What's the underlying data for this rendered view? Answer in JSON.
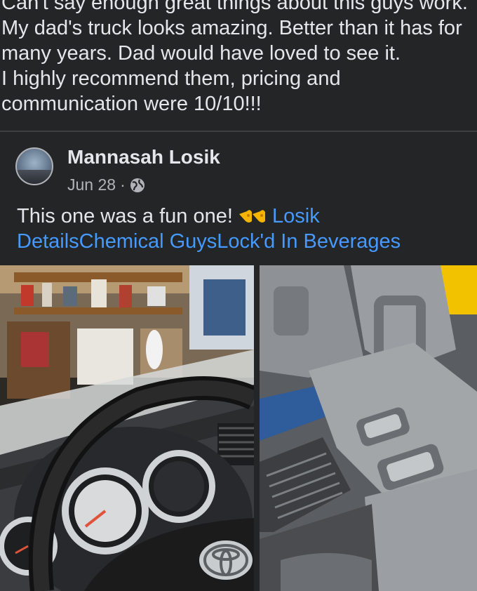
{
  "post": {
    "text_lines": [
      "Can't say enough great things about this guys work.",
      "My dad's truck looks amazing. Better than it has for",
      "many years. Dad would have loved to see it.",
      "I highly recommend them, pricing and",
      "communication were 10/10!!!"
    ]
  },
  "shared_post": {
    "author": "Mannasah Losik",
    "date": "Jun 28",
    "separator": "·",
    "privacy_icon": "globe-icon",
    "text_intro": "This one was a fun one!",
    "emoji": "pointing-hands-emoji",
    "tag_1": "Losik",
    "tag_2": "Details",
    "tag_3": "Chemical Guys",
    "tag_4": "Lock'd In Beverages"
  },
  "photos": [
    {
      "name": "truck-dashboard-photo",
      "brand_badge": "toyota-logo"
    },
    {
      "name": "truck-rear-seat-photo"
    }
  ],
  "colors": {
    "background": "#242526",
    "text": "#e4e6eb",
    "secondary_text": "#b0b3b8",
    "link": "#4599ff",
    "divider": "#3e4042"
  }
}
